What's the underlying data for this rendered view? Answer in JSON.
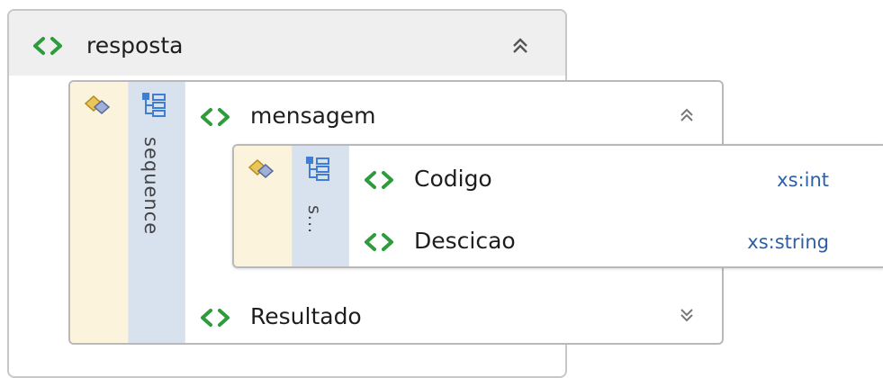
{
  "root": {
    "name": "resposta",
    "collapse_glyph": "⌃"
  },
  "sequence_outer": {
    "label": "sequence"
  },
  "child_mensagem": {
    "name": "mensagem"
  },
  "sequence_inner": {
    "label": "s..."
  },
  "fields": [
    {
      "name": "Codigo",
      "type": "xs:int"
    },
    {
      "name": "Descicao",
      "type": "xs:string"
    }
  ],
  "child_resultado": {
    "name": "Resultado"
  },
  "icons": {
    "element": "element-icon",
    "sequence": "sequence-icon",
    "group": "model-group-icon",
    "collapse": "chevron-up-double-icon",
    "expand": "chevron-down-double-icon"
  },
  "colors": {
    "element_icon": "#2e9b3c",
    "type_text": "#2d5fa8",
    "sequence_bar": "#d8e2ef",
    "group_bar": "#fbf3dc"
  }
}
